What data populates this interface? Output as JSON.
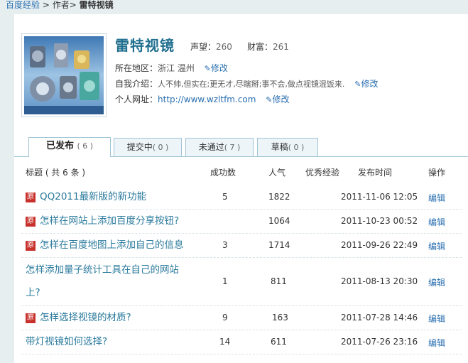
{
  "breadcrumb": {
    "home": "百度经验",
    "sep1": " > ",
    "author": "作者",
    "sep2": "> ",
    "current": "雷特视镜"
  },
  "profile": {
    "name": "雷特视镜",
    "reputation_label": "声望：",
    "reputation": "260",
    "wealth_label": "财富：",
    "wealth": "261",
    "region_label": "所在地区：",
    "region": "浙江 温州",
    "intro_label": "自我介绍：",
    "intro": "人不帅,但实在;更无才,尽瞎掰;事不会,做点视镜混饭来.",
    "site_label": "个人网址：",
    "site": "http://www.wzltfm.com",
    "edit_label": "修改"
  },
  "tabs": [
    {
      "label": "已发布",
      "count": "( 6 )"
    },
    {
      "label": "提交中",
      "count": "( 0 )"
    },
    {
      "label": "未通过",
      "count": "( 7 )"
    },
    {
      "label": "草稿",
      "count": "( 0 )"
    }
  ],
  "table": {
    "headers": {
      "title": "标题 ( 共 6 条 )",
      "success": "成功数",
      "popularity": "人气",
      "excellent": "优秀经验",
      "time": "发布时间",
      "ops": "操作"
    },
    "original_badge": "原",
    "rows": [
      {
        "title": "QQ2011最新版的新功能",
        "original": true,
        "success": "5",
        "views": "1822",
        "time": "2011-11-06 12:05",
        "op": "编辑"
      },
      {
        "title": "怎样在网站上添加百度分享按钮?",
        "original": true,
        "success": "",
        "views": "1064",
        "time": "2011-10-23 00:52",
        "op": "编辑"
      },
      {
        "title": "怎样在百度地图上添加自己的信息",
        "original": true,
        "success": "3",
        "views": "1714",
        "time": "2011-09-26 22:49",
        "op": "编辑"
      },
      {
        "title_line1": "怎样添加量子统计工具在自己的网站",
        "title_line2": "上?",
        "original": false,
        "success": "1",
        "views": "811",
        "time": "2011-08-13 20:30",
        "op": "编辑"
      },
      {
        "title": "怎样选择视镜的材质?",
        "original": true,
        "success": "9",
        "views": "163",
        "time": "2011-07-28 14:46",
        "op": "编辑"
      },
      {
        "title": "带灯视镜如何选择?",
        "original": false,
        "success": "14",
        "views": "611",
        "time": "2011-07-26 23:16",
        "op": "编辑"
      }
    ]
  },
  "colors": {
    "link": "#2a6fb0",
    "title_teal": "#217090",
    "badge_red": "#c8302b",
    "tab_border": "#9fc3d6"
  }
}
